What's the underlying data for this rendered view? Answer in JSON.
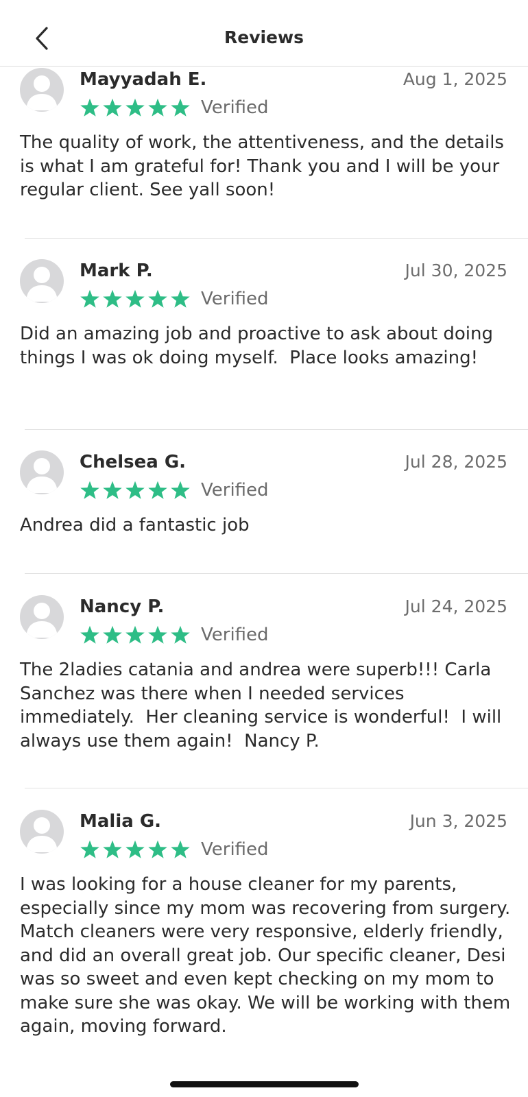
{
  "header": {
    "title": "Reviews",
    "back_icon": "chevron-left-icon"
  },
  "star_color": "#2ebd86",
  "reviews": [
    {
      "name": "Mayyadah E.",
      "date": "Aug 1, 2025",
      "rating": 5,
      "verified_label": "Verified",
      "text": "The quality of work, the attentiveness, and the details is what I am grateful for! Thank you and I will be your regular client. See yall soon!"
    },
    {
      "name": "Mark P.",
      "date": "Jul 30, 2025",
      "rating": 5,
      "verified_label": "Verified",
      "text": "Did an amazing job and proactive to ask about doing things I was ok doing myself.  Place looks amazing!"
    },
    {
      "name": "Chelsea G.",
      "date": "Jul 28, 2025",
      "rating": 5,
      "verified_label": "Verified",
      "text": "Andrea did a fantastic job"
    },
    {
      "name": "Nancy P.",
      "date": "Jul 24, 2025",
      "rating": 5,
      "verified_label": "Verified",
      "text": "The 2ladies catania and andrea were superb!!! Carla Sanchez was there when I needed services immediately.  Her cleaning service is wonderful!  I will always use them again!  Nancy P."
    },
    {
      "name": "Malia G.",
      "date": "Jun 3, 2025",
      "rating": 5,
      "verified_label": "Verified",
      "text": "I was looking for a house cleaner for my parents, especially since my mom was recovering from surgery. Match cleaners were very responsive, elderly friendly, and did an overall great job. Our specific cleaner, Desi was so sweet and even kept checking on my mom to make sure she was okay. We will be working with them again, moving forward."
    }
  ]
}
